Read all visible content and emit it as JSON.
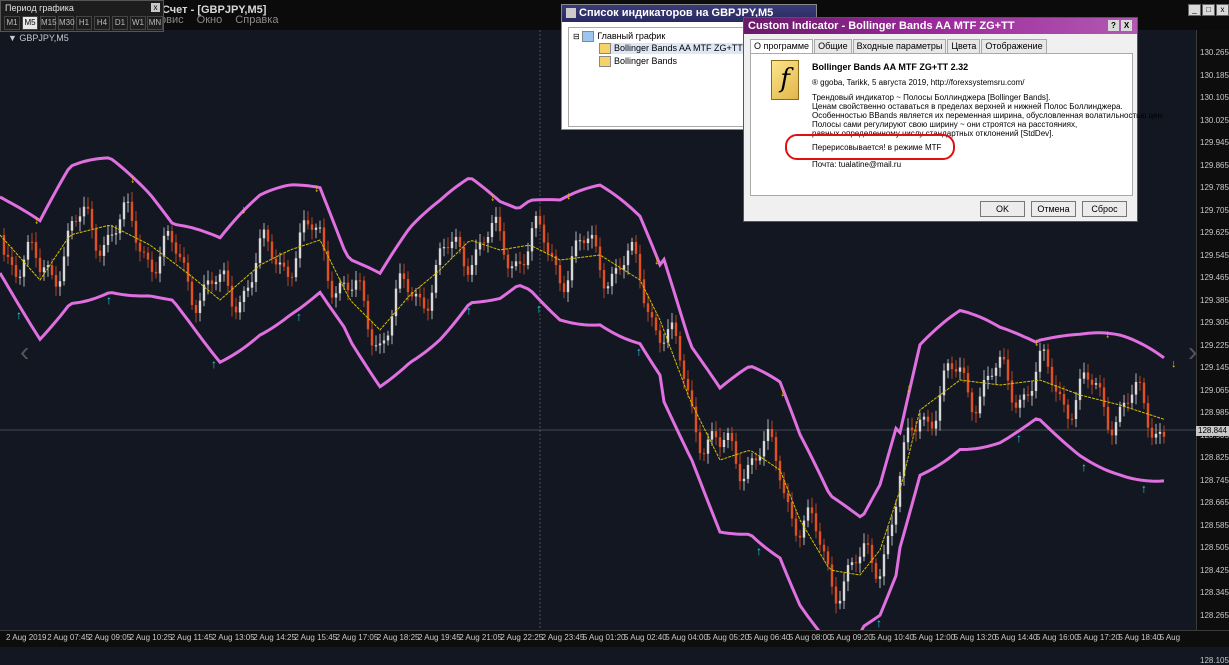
{
  "period_toolbar": {
    "title": "Период графика",
    "close": "x",
    "timeframes": [
      "M1",
      "M5",
      "M15",
      "M30",
      "H1",
      "H4",
      "D1",
      "W1",
      "MN"
    ],
    "active": "M5"
  },
  "main_window": {
    "title": "Счет - [GBPJPY,M5]",
    "menu": [
      "рвис",
      "Окно",
      "Справка"
    ]
  },
  "chart": {
    "symbol_label": "▼ GBPJPY,M5",
    "price_labels": [
      "130.265",
      "130.185",
      "130.105",
      "130.025",
      "129.945",
      "129.865",
      "129.785",
      "129.705",
      "129.625",
      "129.545",
      "129.465",
      "129.385",
      "129.305",
      "129.225",
      "129.145",
      "129.065",
      "128.985",
      "128.905",
      "128.825",
      "128.745",
      "128.665",
      "128.585",
      "128.505",
      "128.425",
      "128.345",
      "128.265",
      "128.185",
      "128.105"
    ],
    "current_price": "128.844",
    "time_labels": [
      "2 Aug 2019",
      "2 Aug 07:45",
      "2 Aug 09:05",
      "2 Aug 10:25",
      "2 Aug 11:45",
      "2 Aug 13:05",
      "2 Aug 14:25",
      "2 Aug 15:45",
      "2 Aug 17:05",
      "2 Aug 18:25",
      "2 Aug 19:45",
      "2 Aug 21:05",
      "2 Aug 22:25",
      "2 Aug 23:45",
      "5 Aug 01:20",
      "5 Aug 02:40",
      "5 Aug 04:00",
      "5 Aug 05:20",
      "5 Aug 06:40",
      "5 Aug 08:00",
      "5 Aug 09:20",
      "5 Aug 10:40",
      "5 Aug 12:00",
      "5 Aug 13:20",
      "5 Aug 14:40",
      "5 Aug 16:00",
      "5 Aug 17:20",
      "5 Aug 18:40",
      "5 Aug"
    ],
    "colors": {
      "bands": "#e070e0",
      "mid": "#d4c000",
      "bull": "#d8d8d8",
      "bear": "#e05020",
      "arrow_up": "#20d8e8",
      "arrow_down": "#f0c000"
    }
  },
  "indicator_list": {
    "title": "Список индикаторов на GBPJPY,M5",
    "root": "Главный график",
    "items": [
      "Bollinger Bands AA MTF ZG+TT",
      "Bollinger Bands"
    ]
  },
  "dialog": {
    "title": "Custom Indicator - Bollinger Bands AA MTF ZG+TT",
    "help": "?",
    "close": "X",
    "tabs": [
      "О программе",
      "Общие",
      "Входные параметры",
      "Цвета",
      "Отображение"
    ],
    "name_version": "Bollinger Bands AA MTF ZG+TT 2.32",
    "copyright": "® ggoba, Tarikk,   5 августа 2019, http://forexsystemsru.com/",
    "description": [
      "Трендовый индикатор ~ Полосы Боллинджера [Bollinger Bands].",
      "Ценам свойственно оставаться в пределах верхней и нижней Полос Боллинджера.",
      "Особенностью BBands является их переменная ширина, обусловленная волатильностью цен.",
      "Полосы сами регулируют свою ширину ~ они строятся на расстояниях,",
      "равных определенному числу стандартных отклонений [StdDev]."
    ],
    "repaint_note": "Перерисовывается! в режиме МТF",
    "email": "Почта:  tualatine@mail.ru",
    "buttons": {
      "ok": "OK",
      "cancel": "Отмена",
      "reset": "Сброс"
    }
  }
}
